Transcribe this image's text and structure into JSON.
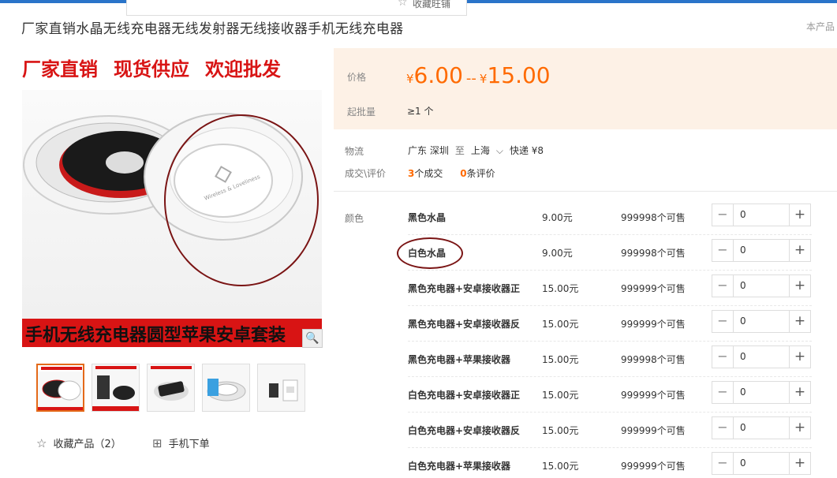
{
  "topbar": {
    "favorite_label": "收藏旺铺"
  },
  "product": {
    "title": "厂家直销水晶无线充电器无线发射器无线接收器手机无线充电器",
    "shop_link": "本产品"
  },
  "image": {
    "banner_top": [
      "厂家直销",
      "现货供应",
      "欢迎批发"
    ],
    "banner_bottom": "手机无线充电器圆型苹果安卓套装",
    "pad_text": "Wireless & Loveliness"
  },
  "actions": {
    "favorite_label": "收藏产品（2）",
    "mobile_order_label": "手机下单"
  },
  "price_box": {
    "price_label": "价格",
    "currency": "¥",
    "price_min": "6.00",
    "price_max": "15.00",
    "price_sep": "--",
    "min_batch_label": "起批量",
    "min_batch_value": "≥1 个"
  },
  "logistics": {
    "label": "物流",
    "from": "广东 深圳",
    "to_word": "至",
    "to": "上海",
    "shipping": "快递 ¥8"
  },
  "deals": {
    "label": "成交\\评价",
    "deals_count": "3",
    "deals_suffix": "个成交",
    "reviews_count": "0",
    "reviews_suffix": "条评价"
  },
  "skus": {
    "label": "颜色",
    "items": [
      {
        "name": "黑色水晶",
        "price": "9.00元",
        "stock": "999998个可售",
        "qty": "0"
      },
      {
        "name": "白色水晶",
        "price": "9.00元",
        "stock": "999998个可售",
        "qty": "0"
      },
      {
        "name": "黑色充电器+安卓接收器正",
        "price": "15.00元",
        "stock": "999999个可售",
        "qty": "0"
      },
      {
        "name": "黑色充电器+安卓接收器反",
        "price": "15.00元",
        "stock": "999999个可售",
        "qty": "0"
      },
      {
        "name": "黑色充电器+苹果接收器",
        "price": "15.00元",
        "stock": "999998个可售",
        "qty": "0"
      },
      {
        "name": "白色充电器+安卓接收器正",
        "price": "15.00元",
        "stock": "999999个可售",
        "qty": "0"
      },
      {
        "name": "白色充电器+安卓接收器反",
        "price": "15.00元",
        "stock": "999999个可售",
        "qty": "0"
      },
      {
        "name": "白色充电器+苹果接收器",
        "price": "15.00元",
        "stock": "999999个可售",
        "qty": "0"
      }
    ]
  },
  "colors": {
    "accent": "#ff6a00",
    "price_bg": "#fdf1e6",
    "annotation": "#7a1414",
    "banner_red": "#d81414"
  }
}
